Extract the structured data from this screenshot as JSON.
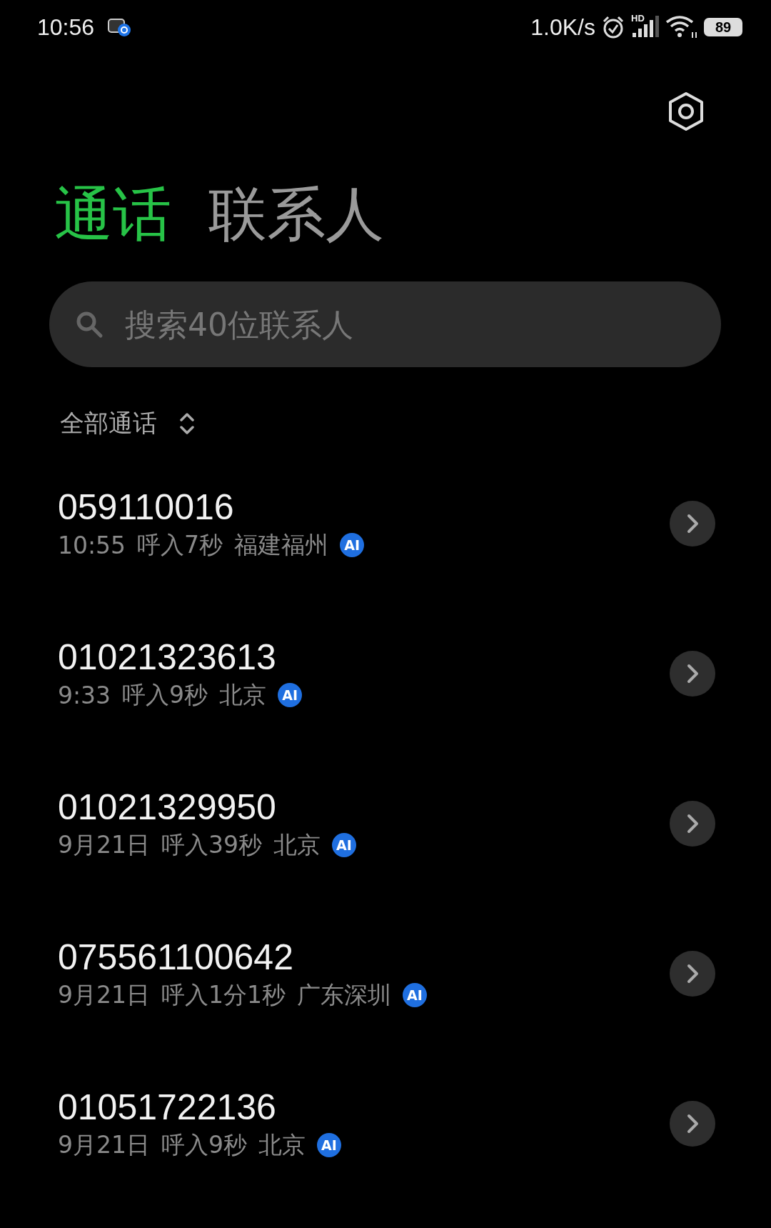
{
  "status_bar": {
    "time": "10:56",
    "net_speed": "1.0K/s",
    "hd_label": "HD",
    "battery": "89"
  },
  "tabs": [
    {
      "label": "通话",
      "selected": true
    },
    {
      "label": "联系人",
      "selected": false
    }
  ],
  "search": {
    "placeholder": "搜索40位联系人"
  },
  "filter": {
    "label": "全部通话"
  },
  "calls": [
    {
      "number": "059110016",
      "time": "10:55",
      "detail": "呼入7秒",
      "location": "福建福州",
      "badge": "AI"
    },
    {
      "number": "01021323613",
      "time": "9:33",
      "detail": "呼入9秒",
      "location": "北京",
      "badge": "AI"
    },
    {
      "number": "01021329950",
      "time": "9月21日",
      "detail": "呼入39秒",
      "location": "北京",
      "badge": "AI"
    },
    {
      "number": "075561100642",
      "time": "9月21日",
      "detail": "呼入1分1秒",
      "location": "广东深圳",
      "badge": "AI"
    },
    {
      "number": "01051722136",
      "time": "9月21日",
      "detail": "呼入9秒",
      "location": "北京",
      "badge": "AI"
    }
  ]
}
